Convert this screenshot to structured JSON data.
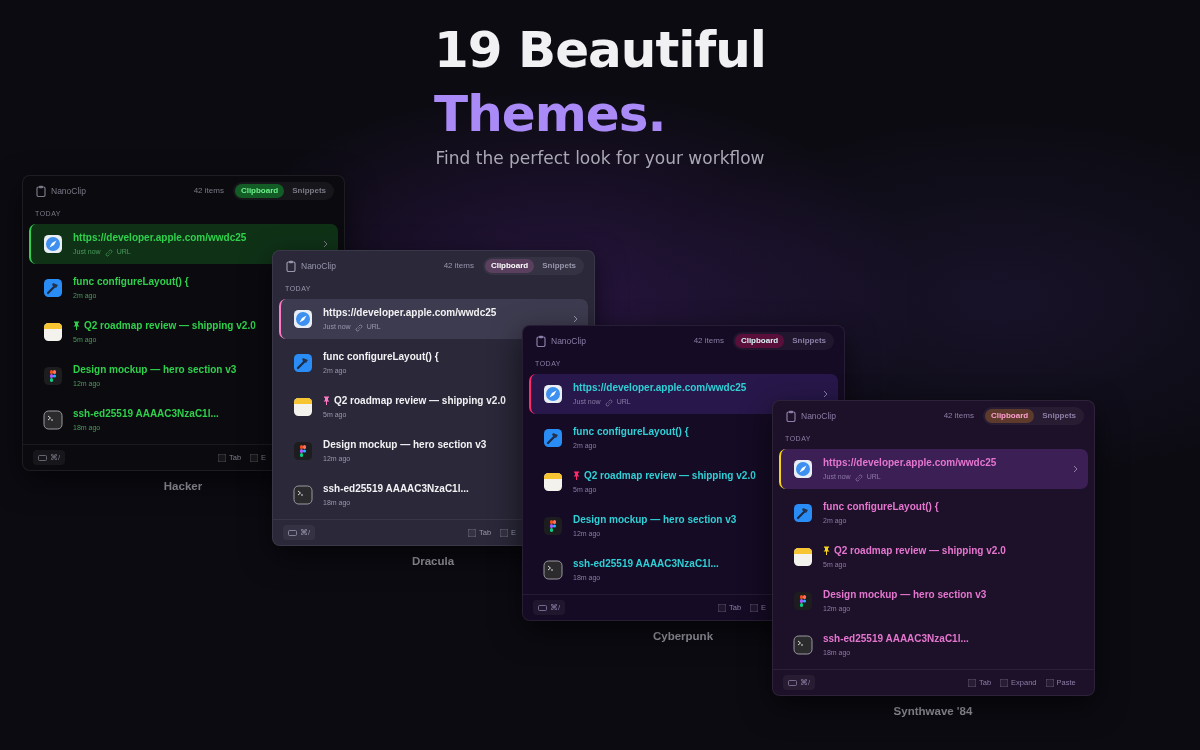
{
  "hero": {
    "title": "19 Beautiful",
    "highlight": "Themes.",
    "subtitle": "Find the perfect look for your workflow"
  },
  "themes": [
    {
      "name": "Hacker",
      "kind": "hacker",
      "app_name": "NanoClip",
      "count": "42 items",
      "tabs": [
        {
          "label": "Clipboard",
          "selected": true
        },
        {
          "label": "Snippets",
          "selected": false
        }
      ],
      "section": "TODAY",
      "items": [
        {
          "kind": "url",
          "title": "https://developer.apple.com/wwdc25",
          "time": "Just now",
          "tag": "URL",
          "pinned": false,
          "selected": true
        },
        {
          "kind": "code",
          "title": "func configureLayout() {",
          "time": "2m ago",
          "pinned": false,
          "selected": false
        },
        {
          "kind": "note",
          "title": "Q2 roadmap review — shipping v2.0",
          "time": "5m ago",
          "pinned": true,
          "selected": false
        },
        {
          "kind": "design",
          "title": "Design mockup — hero section v3",
          "time": "12m ago",
          "pinned": false,
          "selected": false
        },
        {
          "kind": "terminal",
          "title": "ssh-ed25519 AAAAC3NzaC1l...",
          "time": "18m ago",
          "pinned": false,
          "selected": false
        }
      ],
      "shortcut": "⌘/",
      "hints": [
        "Tab",
        "E"
      ]
    },
    {
      "name": "Dracula",
      "kind": "dracula",
      "app_name": "NanoClip",
      "count": "42 items",
      "tabs": [
        {
          "label": "Clipboard",
          "selected": true
        },
        {
          "label": "Snippets",
          "selected": false
        }
      ],
      "section": "TODAY",
      "items": [
        {
          "kind": "url",
          "title": "https://developer.apple.com/wwdc25",
          "time": "Just now",
          "tag": "URL",
          "pinned": false,
          "selected": true
        },
        {
          "kind": "code",
          "title": "func configureLayout() {",
          "time": "2m ago",
          "pinned": false,
          "selected": false
        },
        {
          "kind": "note",
          "title": "Q2 roadmap review — shipping v2.0",
          "time": "5m ago",
          "pinned": true,
          "selected": false
        },
        {
          "kind": "design",
          "title": "Design mockup — hero section v3",
          "time": "12m ago",
          "pinned": false,
          "selected": false
        },
        {
          "kind": "terminal",
          "title": "ssh-ed25519 AAAAC3NzaC1l...",
          "time": "18m ago",
          "pinned": false,
          "selected": false
        }
      ],
      "shortcut": "⌘/",
      "hints": [
        "Tab",
        "E"
      ]
    },
    {
      "name": "Cyberpunk",
      "kind": "cyberpunk",
      "app_name": "NanoClip",
      "count": "42 items",
      "tabs": [
        {
          "label": "Clipboard",
          "selected": true
        },
        {
          "label": "Snippets",
          "selected": false
        }
      ],
      "section": "TODAY",
      "items": [
        {
          "kind": "url",
          "title": "https://developer.apple.com/wwdc25",
          "time": "Just now",
          "tag": "URL",
          "pinned": false,
          "selected": true
        },
        {
          "kind": "code",
          "title": "func configureLayout() {",
          "time": "2m ago",
          "pinned": false,
          "selected": false
        },
        {
          "kind": "note",
          "title": "Q2 roadmap review — shipping v2.0",
          "time": "5m ago",
          "pinned": true,
          "selected": false
        },
        {
          "kind": "design",
          "title": "Design mockup — hero section v3",
          "time": "12m ago",
          "pinned": false,
          "selected": false
        },
        {
          "kind": "terminal",
          "title": "ssh-ed25519 AAAAC3NzaC1l...",
          "time": "18m ago",
          "pinned": false,
          "selected": false
        }
      ],
      "shortcut": "⌘/",
      "hints": [
        "Tab",
        "E"
      ]
    },
    {
      "name": "Synthwave '84",
      "kind": "synthwave",
      "app_name": "NanoClip",
      "count": "42 items",
      "tabs": [
        {
          "label": "Clipboard",
          "selected": true
        },
        {
          "label": "Snippets",
          "selected": false
        }
      ],
      "section": "TODAY",
      "items": [
        {
          "kind": "url",
          "title": "https://developer.apple.com/wwdc25",
          "time": "Just now",
          "tag": "URL",
          "pinned": false,
          "selected": true
        },
        {
          "kind": "code",
          "title": "func configureLayout() {",
          "time": "2m ago",
          "pinned": false,
          "selected": false
        },
        {
          "kind": "note",
          "title": "Q2 roadmap review — shipping v2.0",
          "time": "5m ago",
          "pinned": true,
          "selected": false
        },
        {
          "kind": "design",
          "title": "Design mockup — hero section v3",
          "time": "12m ago",
          "pinned": false,
          "selected": false
        },
        {
          "kind": "terminal",
          "title": "ssh-ed25519 AAAAC3NzaC1l...",
          "time": "18m ago",
          "pinned": false,
          "selected": false
        }
      ],
      "shortcut": "⌘/",
      "hints": [
        "Tab",
        "Expand",
        "Paste"
      ]
    }
  ]
}
